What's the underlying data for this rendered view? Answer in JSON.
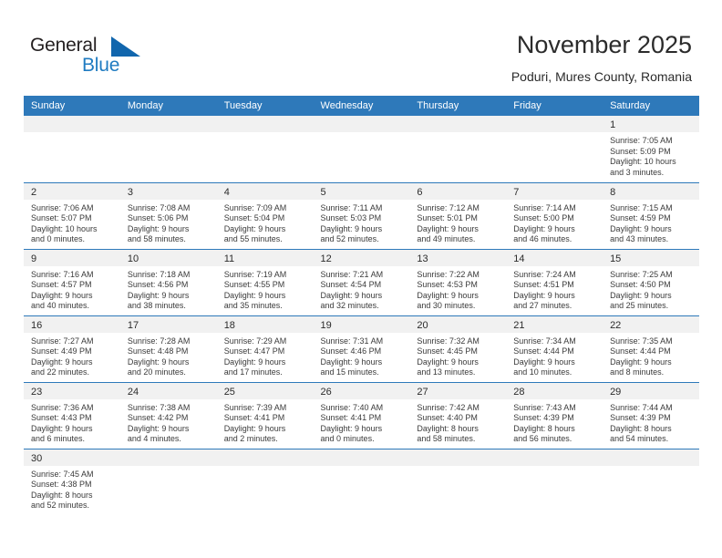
{
  "brand": {
    "name_top": "General",
    "name_bottom": "Blue",
    "color_black": "#231f20",
    "color_blue": "#1f7bc1"
  },
  "header": {
    "title": "November 2025",
    "subtitle": "Poduri, Mures County, Romania"
  },
  "theme": {
    "header_blue": "#2e79ba",
    "daynum_bg": "#f1f1f1",
    "text": "#3a3a3a"
  },
  "weekdays": [
    "Sunday",
    "Monday",
    "Tuesday",
    "Wednesday",
    "Thursday",
    "Friday",
    "Saturday"
  ],
  "weeks": [
    [
      {
        "day": "",
        "blank": true
      },
      {
        "day": "",
        "blank": true
      },
      {
        "day": "",
        "blank": true
      },
      {
        "day": "",
        "blank": true
      },
      {
        "day": "",
        "blank": true
      },
      {
        "day": "",
        "blank": true
      },
      {
        "day": "1",
        "sunrise": "Sunrise: 7:05 AM",
        "sunset": "Sunset: 5:09 PM",
        "daylight1": "Daylight: 10 hours",
        "daylight2": "and 3 minutes."
      }
    ],
    [
      {
        "day": "2",
        "sunrise": "Sunrise: 7:06 AM",
        "sunset": "Sunset: 5:07 PM",
        "daylight1": "Daylight: 10 hours",
        "daylight2": "and 0 minutes."
      },
      {
        "day": "3",
        "sunrise": "Sunrise: 7:08 AM",
        "sunset": "Sunset: 5:06 PM",
        "daylight1": "Daylight: 9 hours",
        "daylight2": "and 58 minutes."
      },
      {
        "day": "4",
        "sunrise": "Sunrise: 7:09 AM",
        "sunset": "Sunset: 5:04 PM",
        "daylight1": "Daylight: 9 hours",
        "daylight2": "and 55 minutes."
      },
      {
        "day": "5",
        "sunrise": "Sunrise: 7:11 AM",
        "sunset": "Sunset: 5:03 PM",
        "daylight1": "Daylight: 9 hours",
        "daylight2": "and 52 minutes."
      },
      {
        "day": "6",
        "sunrise": "Sunrise: 7:12 AM",
        "sunset": "Sunset: 5:01 PM",
        "daylight1": "Daylight: 9 hours",
        "daylight2": "and 49 minutes."
      },
      {
        "day": "7",
        "sunrise": "Sunrise: 7:14 AM",
        "sunset": "Sunset: 5:00 PM",
        "daylight1": "Daylight: 9 hours",
        "daylight2": "and 46 minutes."
      },
      {
        "day": "8",
        "sunrise": "Sunrise: 7:15 AM",
        "sunset": "Sunset: 4:59 PM",
        "daylight1": "Daylight: 9 hours",
        "daylight2": "and 43 minutes."
      }
    ],
    [
      {
        "day": "9",
        "sunrise": "Sunrise: 7:16 AM",
        "sunset": "Sunset: 4:57 PM",
        "daylight1": "Daylight: 9 hours",
        "daylight2": "and 40 minutes."
      },
      {
        "day": "10",
        "sunrise": "Sunrise: 7:18 AM",
        "sunset": "Sunset: 4:56 PM",
        "daylight1": "Daylight: 9 hours",
        "daylight2": "and 38 minutes."
      },
      {
        "day": "11",
        "sunrise": "Sunrise: 7:19 AM",
        "sunset": "Sunset: 4:55 PM",
        "daylight1": "Daylight: 9 hours",
        "daylight2": "and 35 minutes."
      },
      {
        "day": "12",
        "sunrise": "Sunrise: 7:21 AM",
        "sunset": "Sunset: 4:54 PM",
        "daylight1": "Daylight: 9 hours",
        "daylight2": "and 32 minutes."
      },
      {
        "day": "13",
        "sunrise": "Sunrise: 7:22 AM",
        "sunset": "Sunset: 4:53 PM",
        "daylight1": "Daylight: 9 hours",
        "daylight2": "and 30 minutes."
      },
      {
        "day": "14",
        "sunrise": "Sunrise: 7:24 AM",
        "sunset": "Sunset: 4:51 PM",
        "daylight1": "Daylight: 9 hours",
        "daylight2": "and 27 minutes."
      },
      {
        "day": "15",
        "sunrise": "Sunrise: 7:25 AM",
        "sunset": "Sunset: 4:50 PM",
        "daylight1": "Daylight: 9 hours",
        "daylight2": "and 25 minutes."
      }
    ],
    [
      {
        "day": "16",
        "sunrise": "Sunrise: 7:27 AM",
        "sunset": "Sunset: 4:49 PM",
        "daylight1": "Daylight: 9 hours",
        "daylight2": "and 22 minutes."
      },
      {
        "day": "17",
        "sunrise": "Sunrise: 7:28 AM",
        "sunset": "Sunset: 4:48 PM",
        "daylight1": "Daylight: 9 hours",
        "daylight2": "and 20 minutes."
      },
      {
        "day": "18",
        "sunrise": "Sunrise: 7:29 AM",
        "sunset": "Sunset: 4:47 PM",
        "daylight1": "Daylight: 9 hours",
        "daylight2": "and 17 minutes."
      },
      {
        "day": "19",
        "sunrise": "Sunrise: 7:31 AM",
        "sunset": "Sunset: 4:46 PM",
        "daylight1": "Daylight: 9 hours",
        "daylight2": "and 15 minutes."
      },
      {
        "day": "20",
        "sunrise": "Sunrise: 7:32 AM",
        "sunset": "Sunset: 4:45 PM",
        "daylight1": "Daylight: 9 hours",
        "daylight2": "and 13 minutes."
      },
      {
        "day": "21",
        "sunrise": "Sunrise: 7:34 AM",
        "sunset": "Sunset: 4:44 PM",
        "daylight1": "Daylight: 9 hours",
        "daylight2": "and 10 minutes."
      },
      {
        "day": "22",
        "sunrise": "Sunrise: 7:35 AM",
        "sunset": "Sunset: 4:44 PM",
        "daylight1": "Daylight: 9 hours",
        "daylight2": "and 8 minutes."
      }
    ],
    [
      {
        "day": "23",
        "sunrise": "Sunrise: 7:36 AM",
        "sunset": "Sunset: 4:43 PM",
        "daylight1": "Daylight: 9 hours",
        "daylight2": "and 6 minutes."
      },
      {
        "day": "24",
        "sunrise": "Sunrise: 7:38 AM",
        "sunset": "Sunset: 4:42 PM",
        "daylight1": "Daylight: 9 hours",
        "daylight2": "and 4 minutes."
      },
      {
        "day": "25",
        "sunrise": "Sunrise: 7:39 AM",
        "sunset": "Sunset: 4:41 PM",
        "daylight1": "Daylight: 9 hours",
        "daylight2": "and 2 minutes."
      },
      {
        "day": "26",
        "sunrise": "Sunrise: 7:40 AM",
        "sunset": "Sunset: 4:41 PM",
        "daylight1": "Daylight: 9 hours",
        "daylight2": "and 0 minutes."
      },
      {
        "day": "27",
        "sunrise": "Sunrise: 7:42 AM",
        "sunset": "Sunset: 4:40 PM",
        "daylight1": "Daylight: 8 hours",
        "daylight2": "and 58 minutes."
      },
      {
        "day": "28",
        "sunrise": "Sunrise: 7:43 AM",
        "sunset": "Sunset: 4:39 PM",
        "daylight1": "Daylight: 8 hours",
        "daylight2": "and 56 minutes."
      },
      {
        "day": "29",
        "sunrise": "Sunrise: 7:44 AM",
        "sunset": "Sunset: 4:39 PM",
        "daylight1": "Daylight: 8 hours",
        "daylight2": "and 54 minutes."
      }
    ],
    [
      {
        "day": "30",
        "sunrise": "Sunrise: 7:45 AM",
        "sunset": "Sunset: 4:38 PM",
        "daylight1": "Daylight: 8 hours",
        "daylight2": "and 52 minutes."
      },
      {
        "day": "",
        "blank": true
      },
      {
        "day": "",
        "blank": true
      },
      {
        "day": "",
        "blank": true
      },
      {
        "day": "",
        "blank": true
      },
      {
        "day": "",
        "blank": true
      },
      {
        "day": "",
        "blank": true
      }
    ]
  ]
}
